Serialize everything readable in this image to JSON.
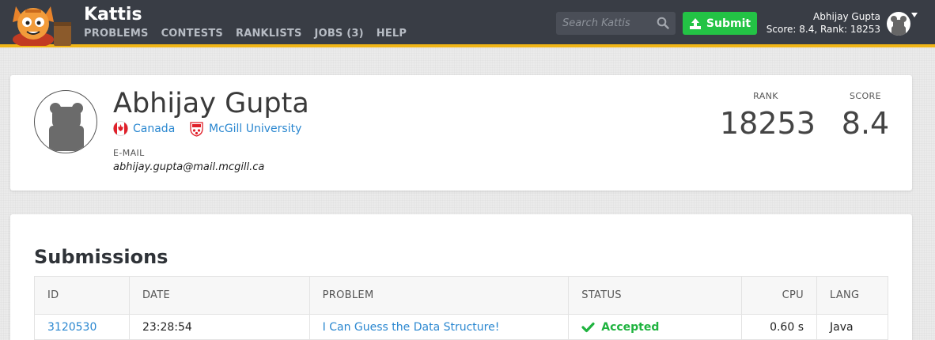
{
  "header": {
    "brand": "Kattis",
    "nav": [
      "PROBLEMS",
      "CONTESTS",
      "RANKLISTS",
      "JOBS (3)",
      "HELP"
    ],
    "search_placeholder": "Search Kattis",
    "submit_label": "Submit",
    "user_name": "Abhijay Gupta",
    "user_stats": "Score: 8.4, Rank: 18253",
    "accent_color": "#f1b515",
    "submit_color": "#23c345"
  },
  "profile": {
    "name": "Abhijay Gupta",
    "country": "Canada",
    "university": "McGill University",
    "email_label": "E-MAIL",
    "email": "abhijay.gupta@mail.mcgill.ca",
    "rank_label": "RANK",
    "rank": "18253",
    "score_label": "SCORE",
    "score": "8.4"
  },
  "submissions": {
    "title": "Submissions",
    "columns": [
      "ID",
      "DATE",
      "PROBLEM",
      "STATUS",
      "CPU",
      "LANG"
    ],
    "rows": [
      {
        "id": "3120530",
        "date": "23:28:54",
        "problem": "I Can Guess the Data Structure!",
        "status": "Accepted",
        "cpu": "0.60 s",
        "lang": "Java"
      }
    ],
    "accepted_color": "#1fb33f"
  },
  "icons": {
    "logo": "kattis-cat-logo",
    "search": "search-icon",
    "submit": "upload-icon",
    "avatar": "user-avatar-icon",
    "caret": "caret-down-icon",
    "country_flag": "canada-flag-icon",
    "university": "mcgill-crest-icon",
    "status": "check-icon"
  }
}
